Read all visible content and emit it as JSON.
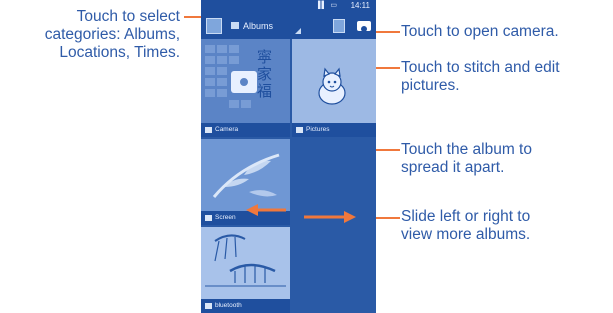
{
  "callouts": {
    "categories": [
      "Touch to select",
      "categories: Albums,",
      "Locations, Times."
    ],
    "camera": [
      "Touch to open camera."
    ],
    "stitch": [
      "Touch to stitch and edit",
      "pictures."
    ],
    "album": [
      "Touch the album to",
      "spread it apart."
    ],
    "slide": [
      "Slide left or right to",
      "view more albums."
    ]
  },
  "phone": {
    "status": {
      "time": "14:11",
      "icons": "▐▌ ▭"
    },
    "action_bar": {
      "selector_label": "Albums"
    },
    "albums": [
      {
        "name": "Camera"
      },
      {
        "name": "Pictures"
      },
      {
        "name": "Screen"
      },
      {
        "name": "bluetooth"
      }
    ],
    "calendar_glyphs": "寜\n家\n福"
  },
  "colors": {
    "callout_text": "#2f5ba8",
    "leader_line": "#f0783c",
    "ui_blue": "#1f4f9e"
  }
}
